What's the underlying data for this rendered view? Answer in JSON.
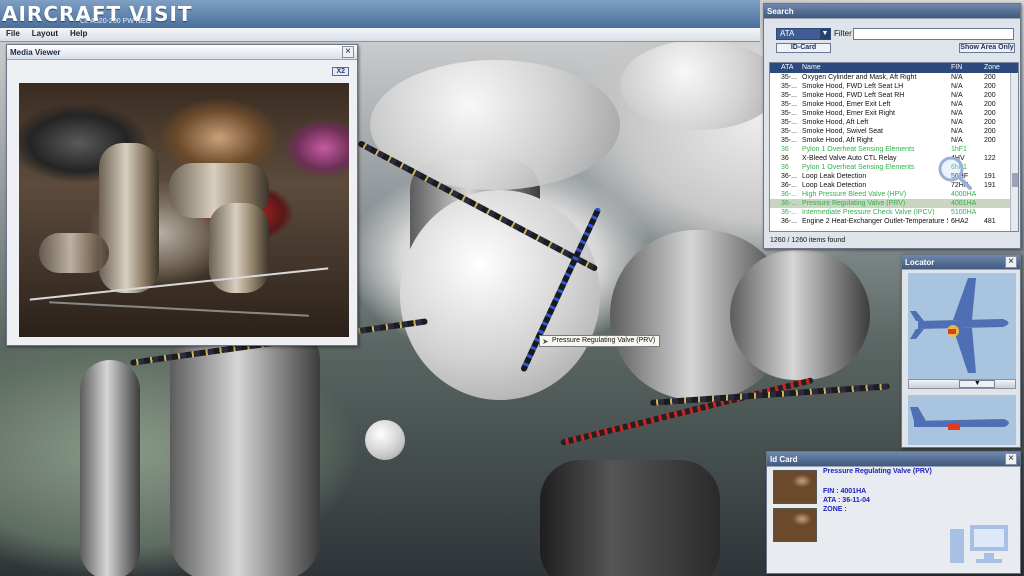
{
  "app": {
    "title": "AIRCRAFT VISIT",
    "subtitle": "CL A320-200 PW NEO"
  },
  "menu": [
    "File",
    "Layout",
    "Help"
  ],
  "media_viewer": {
    "title": "Media Viewer",
    "zoom_label": "X2",
    "close_icon": "close-icon"
  },
  "search": {
    "title": "Search",
    "ata_selected": "ATA",
    "filter_label": "Filter :",
    "filter_value": "",
    "idcard_button": "ID-Card",
    "show_area_button": "Show Area Only",
    "columns": [
      "ATA",
      "Name",
      "FIN",
      "Zone"
    ],
    "rows": [
      {
        "ata": "35-...",
        "name": "Oxygen Cylinder and Mask, Aft Right",
        "fin": "N/A",
        "zone": "200",
        "style": "normal"
      },
      {
        "ata": "35-...",
        "name": "Smoke Hood, FWD Left Seat LH",
        "fin": "N/A",
        "zone": "200",
        "style": "normal"
      },
      {
        "ata": "35-...",
        "name": "Smoke Hood, FWD Left Seat RH",
        "fin": "N/A",
        "zone": "200",
        "style": "normal"
      },
      {
        "ata": "35-...",
        "name": "Smoke Hood, Emer Exit Left",
        "fin": "N/A",
        "zone": "200",
        "style": "normal"
      },
      {
        "ata": "35-...",
        "name": "Smoke Hood, Emer Exit Right",
        "fin": "N/A",
        "zone": "200",
        "style": "normal"
      },
      {
        "ata": "35-...",
        "name": "Smoke Hood, Aft Left",
        "fin": "N/A",
        "zone": "200",
        "style": "normal"
      },
      {
        "ata": "35-...",
        "name": "Smoke Hood, Swivel Seat",
        "fin": "N/A",
        "zone": "200",
        "style": "normal"
      },
      {
        "ata": "35-...",
        "name": "Smoke Hood, Aft Right",
        "fin": "N/A",
        "zone": "200",
        "style": "normal"
      },
      {
        "ata": "36",
        "name": "Pylon 1 Overheat Sensing Elements",
        "fin": "1hF1",
        "zone": "",
        "style": "green"
      },
      {
        "ata": "36",
        "name": "X-Bleed Valve Auto CTL Relay",
        "fin": "4HV",
        "zone": "122",
        "style": "normal"
      },
      {
        "ata": "36",
        "name": "Pylon 1 Overheat Sensing Elements",
        "fin": "6hF1",
        "zone": "",
        "style": "green"
      },
      {
        "ata": "36-...",
        "name": "Loop Leak Detection",
        "fin": "56HF",
        "zone": "191",
        "style": "normal"
      },
      {
        "ata": "36-...",
        "name": "Loop Leak Detection",
        "fin": "72HF",
        "zone": "191",
        "style": "normal"
      },
      {
        "ata": "36-...",
        "name": "High Pressure Bleed Valve (HPV)",
        "fin": "4000HA",
        "zone": "",
        "style": "green"
      },
      {
        "ata": "36-...",
        "name": "Pressure Regulating Valve (PRV)",
        "fin": "4001HA",
        "zone": "",
        "style": "selected"
      },
      {
        "ata": "36-...",
        "name": "Intermediate Pressure Check Valve (IPCV)",
        "fin": "5100HA",
        "zone": "",
        "style": "green"
      },
      {
        "ata": "36-...",
        "name": "Engine 2 Heat-Exchanger Outlet-Temperature Se...",
        "fin": "6HA2",
        "zone": "481",
        "style": "normal"
      }
    ],
    "status": "1260 / 1260 items found"
  },
  "locator": {
    "title": "Locator",
    "slider_value": 0.72,
    "colors": {
      "aircraft": "#4e6fb3",
      "highlight": "#e23a1e",
      "zone": "#f2c230"
    }
  },
  "idcard": {
    "title": "Id Card",
    "name": "Pressure Regulating Valve (PRV)",
    "fin": "FIN : 4001HA",
    "ata": "ATA : 36-11-04",
    "zone": "ZONE :"
  },
  "tooltip": {
    "text": "Pressure Regulating Valve (PRV)"
  },
  "colors": {
    "header": "#4a6f9c",
    "panel_header": "#41587f",
    "green_item": "#2fb34a",
    "idcard_text": "#1b1ec0"
  }
}
